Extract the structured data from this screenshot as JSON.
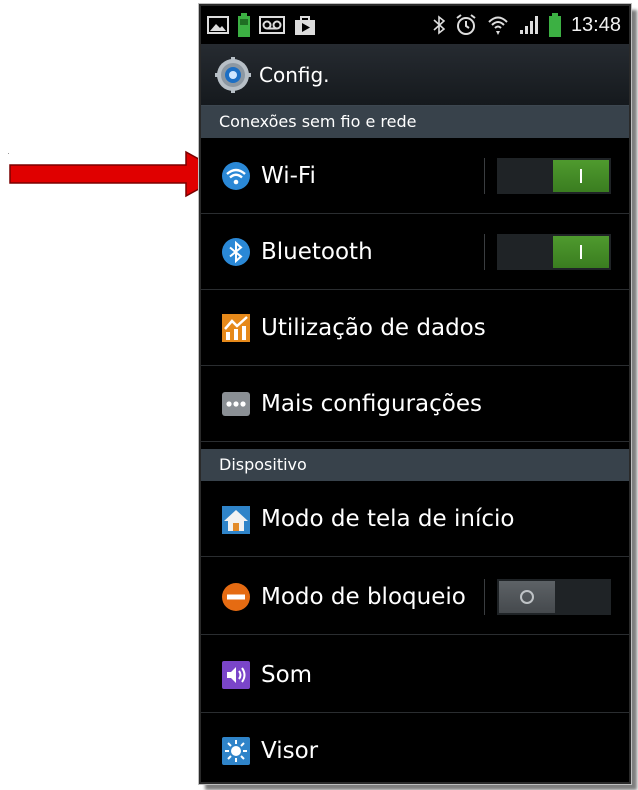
{
  "status_bar": {
    "time": "13:48",
    "left_icons": [
      "image-icon",
      "battery-icon",
      "voicemail-icon",
      "play-store-icon"
    ],
    "right_icons": [
      "bluetooth-icon",
      "alarm-icon",
      "wifi-icon",
      "signal-icon",
      "battery-icon"
    ]
  },
  "action_bar": {
    "title": "Config.",
    "icon": "gear-icon"
  },
  "sections": {
    "wireless": "Conexões sem fio e rede",
    "device": "Dispositivo"
  },
  "items": [
    {
      "label": "Wi-Fi",
      "icon": "wifi-icon",
      "toggle": true,
      "toggle_on": true
    },
    {
      "label": "Bluetooth",
      "icon": "bluetooth-icon",
      "toggle": true,
      "toggle_on": true
    },
    {
      "label": "Utilização de dados",
      "icon": "data-usage-icon",
      "toggle": false
    },
    {
      "label": "Mais configurações",
      "icon": "more-icon",
      "toggle": false
    },
    {
      "label": "Modo de tela de início",
      "icon": "home-screen-icon",
      "toggle": false
    },
    {
      "label": "Modo de bloqueio",
      "icon": "block-icon",
      "toggle": true,
      "toggle_on": false
    },
    {
      "label": "Som",
      "icon": "sound-icon",
      "toggle": false
    },
    {
      "label": "Visor",
      "icon": "display-icon",
      "toggle": false
    }
  ],
  "colors": {
    "accent_green": "#4f9a2e",
    "section_bg": "#38424b",
    "arrow_red": "#e00000"
  }
}
